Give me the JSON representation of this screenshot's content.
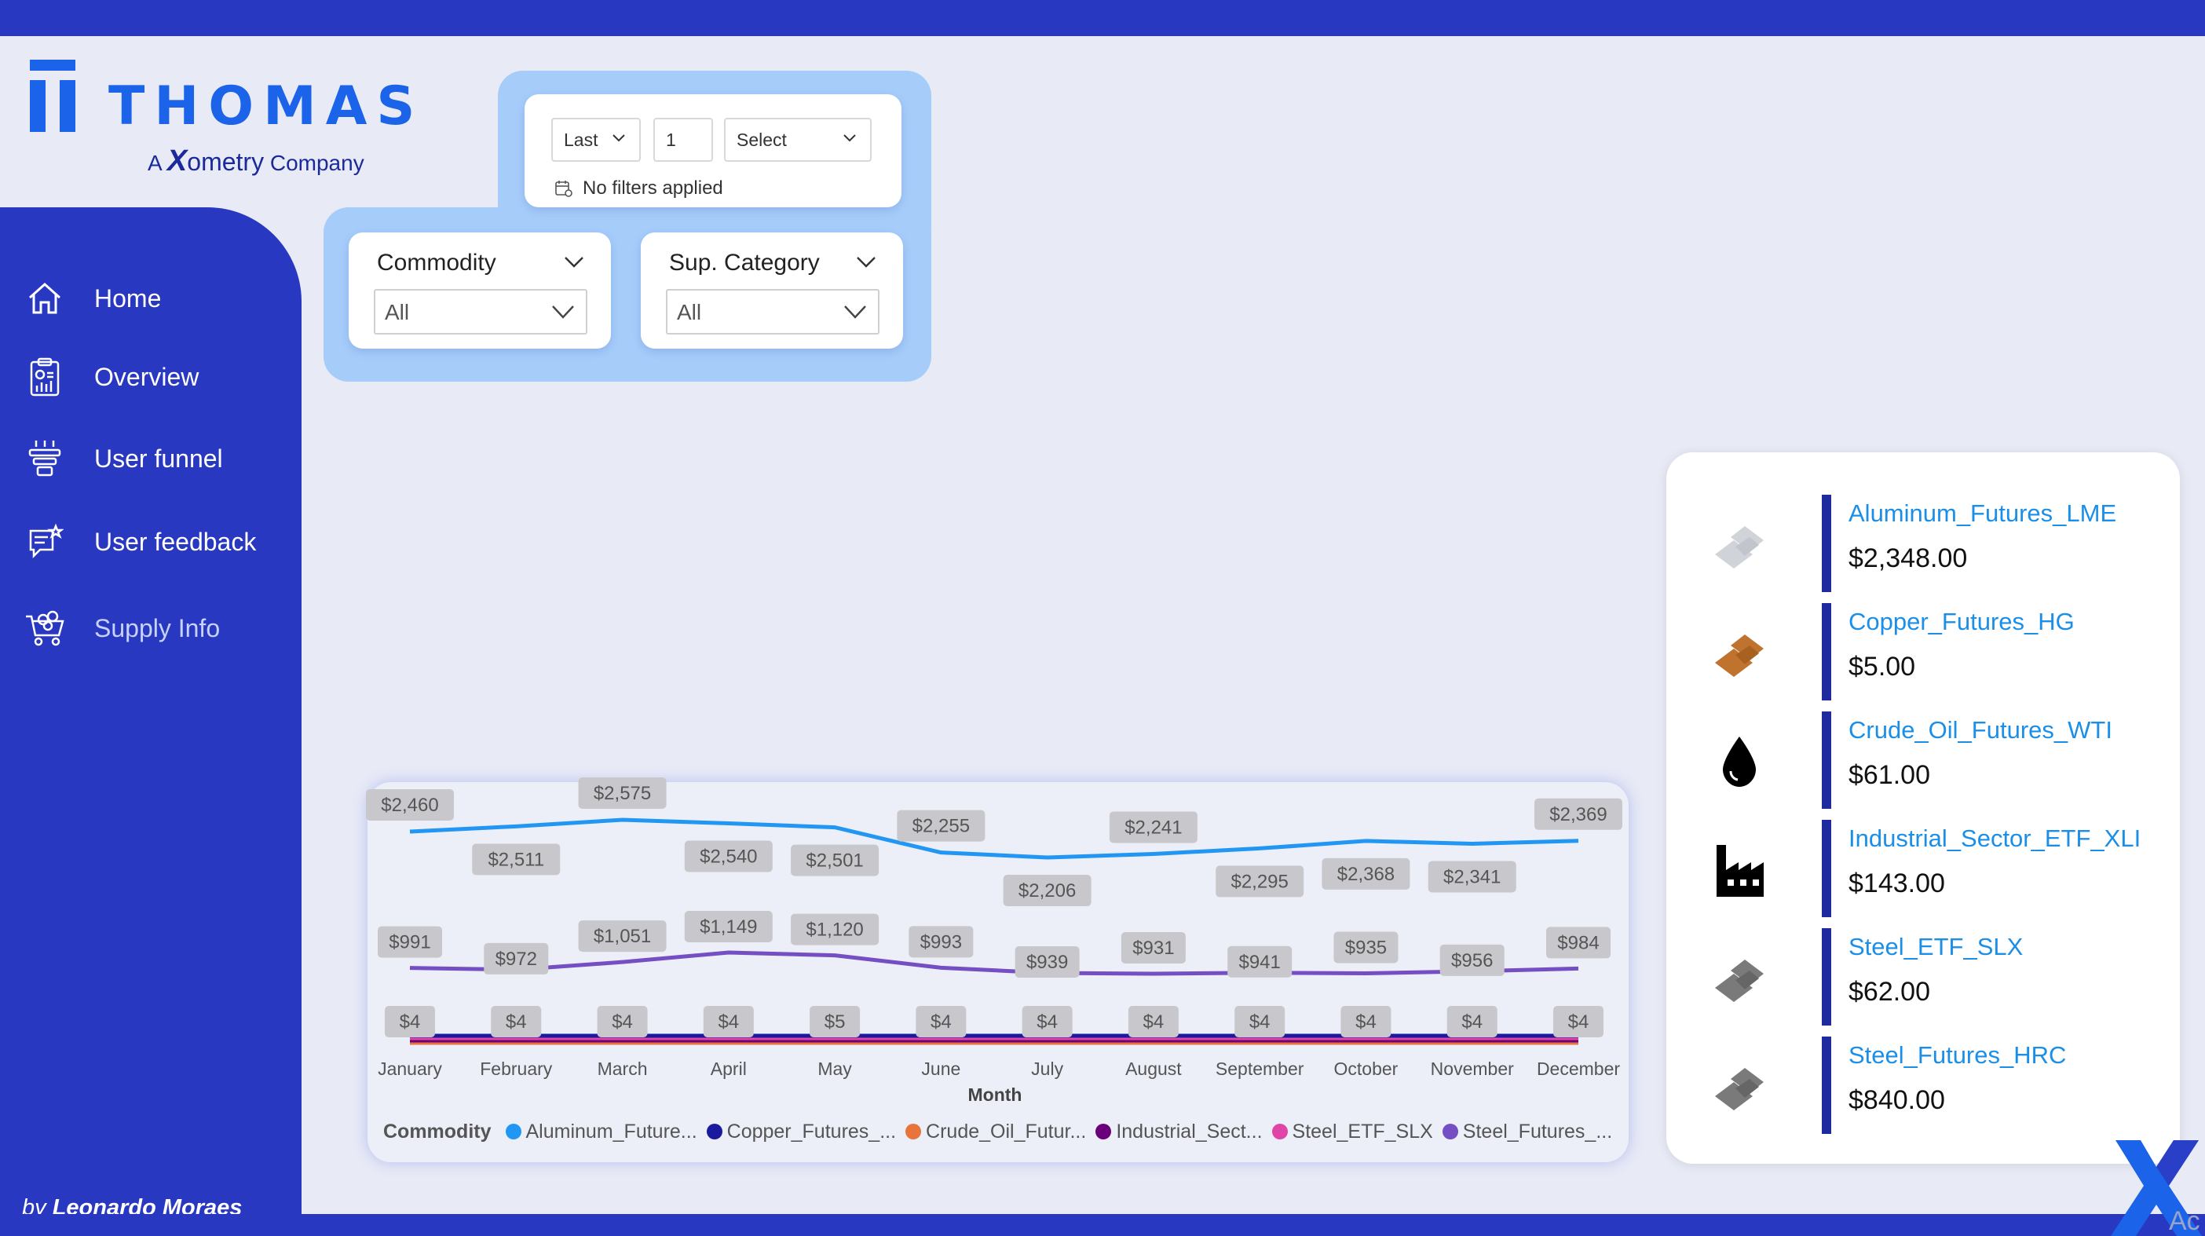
{
  "brand": {
    "name": "THOMAS",
    "tm": "™",
    "sub_prefix": "A",
    "sub_x": "X",
    "sub_name": "ometry",
    "sub_suffix": "Company"
  },
  "sidebar": {
    "items": [
      {
        "label": "Home",
        "icon": "home-icon"
      },
      {
        "label": "Overview",
        "icon": "report-icon"
      },
      {
        "label": "User funnel",
        "icon": "funnel-icon"
      },
      {
        "label": "User feedback",
        "icon": "feedback-icon"
      },
      {
        "label": "Supply Info",
        "icon": "cart-icon",
        "active": true
      }
    ],
    "byline_prefix": "by",
    "byline_name": "Leonardo Moraes"
  },
  "date_filter": {
    "mode": "Last",
    "count": "1",
    "unit": "Select",
    "status": "No filters applied"
  },
  "slicers": [
    {
      "title": "Commodity",
      "value": "All"
    },
    {
      "title": "Sup. Category",
      "value": "All"
    }
  ],
  "chart_data": {
    "type": "line",
    "xlabel": "Month",
    "categories": [
      "January",
      "February",
      "March",
      "April",
      "May",
      "June",
      "July",
      "August",
      "September",
      "October",
      "November",
      "December"
    ],
    "legend_title": "Commodity",
    "series": [
      {
        "name": "Aluminum_Future...",
        "color": "#2196f3",
        "values": [
          2460,
          2511,
          2575,
          2540,
          2501,
          2255,
          2206,
          2241,
          2295,
          2368,
          2341,
          2369
        ],
        "labels": [
          "$2,460",
          "$2,511",
          "$2,575",
          "$2,540",
          "$2,501",
          "$2,255",
          "$2,206",
          "$2,241",
          "$2,295",
          "$2,368",
          "$2,341",
          "$2,369"
        ]
      },
      {
        "name": "Copper_Futures_...",
        "color": "#1a1a9e",
        "values": [
          4,
          4,
          4,
          4,
          5,
          4,
          4,
          4,
          4,
          4,
          4,
          4
        ]
      },
      {
        "name": "Crude_Oil_Futur...",
        "color": "#e8743b",
        "values": [
          61,
          61,
          61,
          61,
          61,
          61,
          61,
          61,
          61,
          61,
          61,
          61
        ]
      },
      {
        "name": "Industrial_Sect...",
        "color": "#6b007b",
        "values": [
          143,
          143,
          143,
          143,
          143,
          143,
          143,
          143,
          143,
          143,
          143,
          143
        ]
      },
      {
        "name": "Steel_ETF_SLX",
        "color": "#e044a7",
        "values": [
          62,
          62,
          62,
          62,
          62,
          62,
          62,
          62,
          62,
          62,
          62,
          62
        ]
      },
      {
        "name": "Steel_Futures_...",
        "color": "#744ec2",
        "values": [
          991,
          972,
          1051,
          1149,
          1120,
          993,
          939,
          931,
          941,
          935,
          956,
          984
        ],
        "labels": [
          "$991",
          "$972",
          "$1,051",
          "$1,149",
          "$1,120",
          "$993",
          "$939",
          "$931",
          "$941",
          "$935",
          "$956",
          "$984"
        ]
      }
    ],
    "bottom_labels": [
      "$4",
      "$4",
      "$4",
      "$4",
      "$5",
      "$4",
      "$4",
      "$4",
      "$4",
      "$4",
      "$4",
      "$4"
    ]
  },
  "prices": [
    {
      "name": "Aluminum_Futures_LME",
      "price": "$2,348.00",
      "icon": "ingot-icon",
      "color": "#d0d3d8"
    },
    {
      "name": "Copper_Futures_HG",
      "price": "$5.00",
      "icon": "ingot-icon",
      "color": "#c0732f"
    },
    {
      "name": "Crude_Oil_Futures_WTI",
      "price": "$61.00",
      "icon": "oil-drop-icon",
      "color": "#000000"
    },
    {
      "name": "Industrial_Sector_ETF_XLI",
      "price": "$143.00",
      "icon": "factory-icon",
      "color": "#000000"
    },
    {
      "name": "Steel_ETF_SLX",
      "price": "$62.00",
      "icon": "ingot-icon",
      "color": "#7a7a7a"
    },
    {
      "name": "Steel_Futures_HRC",
      "price": "$840.00",
      "icon": "ingot-icon",
      "color": "#7a7a7a"
    }
  ],
  "corner": {
    "text": "Ac"
  }
}
